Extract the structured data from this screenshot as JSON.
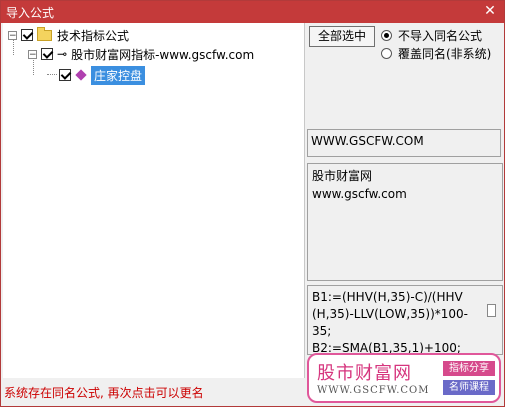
{
  "window": {
    "title": "导入公式",
    "close_glyph": "✕"
  },
  "tree": {
    "root": {
      "label": "技术指标公式",
      "expander": "−"
    },
    "child": {
      "label": "股市财富网指标-www.gscfw.com",
      "expander": "−"
    },
    "leaf": {
      "label": "庄家控盘"
    }
  },
  "controls": {
    "select_all_label": "全部选中",
    "radio_no_import": "不导入同名公式",
    "radio_overwrite": "覆盖同名(非系统)"
  },
  "info": {
    "url": "WWW.GSCFW.COM",
    "desc_line1": "股市财富网",
    "desc_line2": "www.gscfw.com",
    "code_lines": [
      "B1:=(HHV(H,35)-C)/(HHV",
      "(H,35)-LLV(LOW,35))*100-",
      "35;",
      "B2:=SMA(B1,35,1)+100;"
    ]
  },
  "status": {
    "message": "系统存在同名公式, 再次点击可以更名"
  },
  "watermark": {
    "brand": "股市财富网",
    "url": "WWW.GSCFW.COM",
    "tag1": "指标分享",
    "tag2": "名师课程"
  }
}
